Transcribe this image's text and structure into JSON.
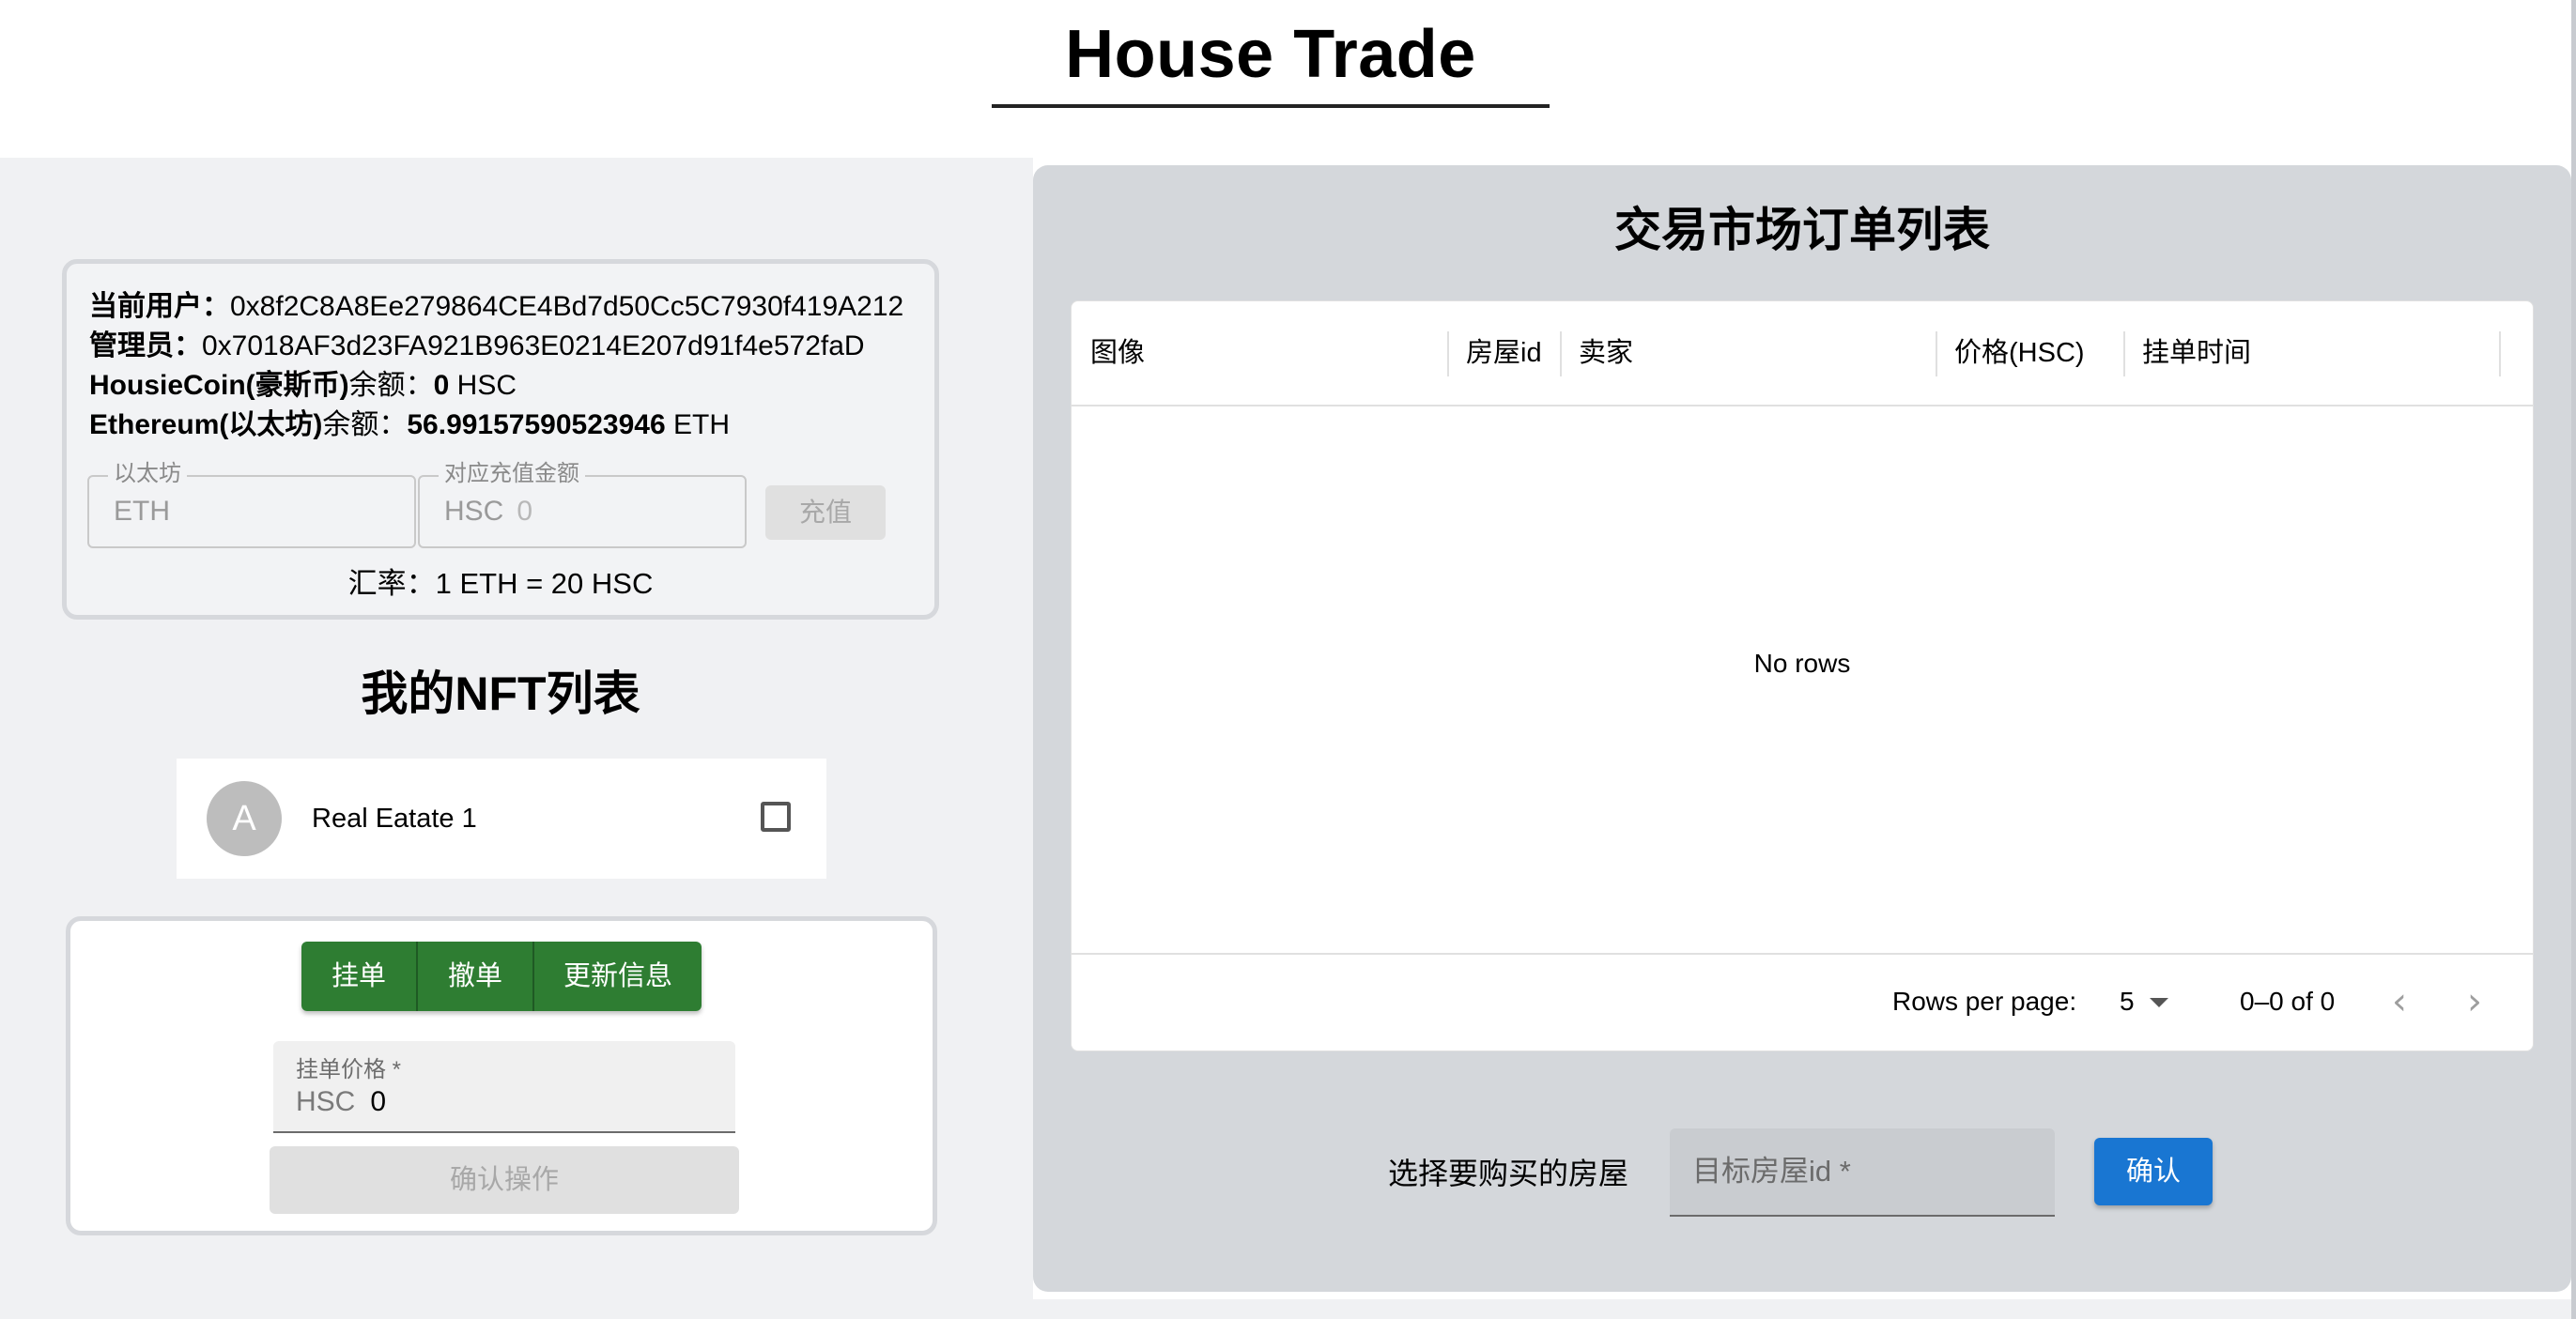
{
  "header": {
    "title": "House Trade"
  },
  "account": {
    "user_label": "当前用户：",
    "user_value": "0x8f2C8A8Ee279864CE4Bd7d50Cc5C7930f419A212",
    "admin_label": "管理员：",
    "admin_value": "0x7018AF3d23FA921B963E0214E207d91f4e572faD",
    "hsc_label": "HousieCoin(豪斯币)",
    "hsc_suffix": "余额：",
    "hsc_value": "0",
    "hsc_unit": " HSC",
    "eth_label": "Ethereum(以太坊)",
    "eth_suffix": "余额：",
    "eth_value": "56.99157590523946",
    "eth_unit": " ETH",
    "eth_field": {
      "legend": "以太坊",
      "prefix": "ETH",
      "value": ""
    },
    "hsc_field": {
      "legend": "对应充值金额",
      "prefix": "HSC",
      "value": "0"
    },
    "recharge_button": "充值",
    "rate_text": "汇率：1 ETH = 20 HSC"
  },
  "nft_section": {
    "title": "我的NFT列表",
    "items": [
      {
        "avatar_letter": "A",
        "name": "Real Eatate 1",
        "checked": false
      }
    ]
  },
  "actions": {
    "buttons": [
      "挂单",
      "撤单",
      "更新信息"
    ],
    "price_field": {
      "label": "挂单价格 *",
      "prefix": "HSC",
      "value": "0"
    },
    "confirm_button": "确认操作"
  },
  "market": {
    "title": "交易市场订单列表",
    "columns": [
      "图像",
      "房屋id",
      "卖家",
      "价格(HSC)",
      "挂单时间"
    ],
    "rows": [],
    "empty_text": "No rows",
    "footer": {
      "rows_per_page_label": "Rows per page:",
      "rows_per_page_value": "5",
      "range_text": "0–0 of 0"
    }
  },
  "purchase": {
    "label": "选择要购买的房屋",
    "field_placeholder": "目标房屋id *",
    "confirm_button": "确认"
  },
  "colors": {
    "green_button": "#2e7d32",
    "blue_button": "#1976d2",
    "panel_gray": "#d4d7db",
    "page_gray": "#f0f1f3"
  }
}
